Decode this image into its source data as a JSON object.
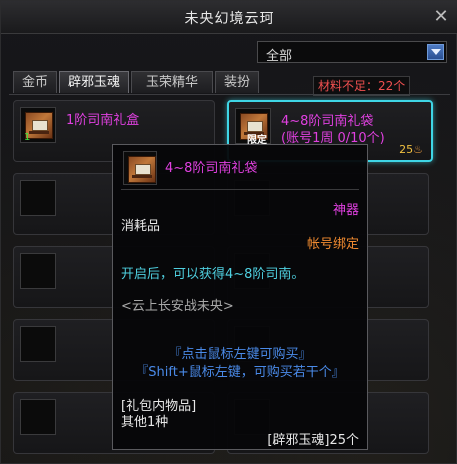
{
  "window": {
    "title": "未央幻境云珂",
    "close_glyph": "✕"
  },
  "filter": {
    "selected": "全部"
  },
  "tabs": [
    {
      "label": "金币",
      "active": false
    },
    {
      "label": "辟邪玉魂",
      "active": true
    },
    {
      "label": "玉荣精华",
      "active": false
    },
    {
      "label": "装扮",
      "active": false
    }
  ],
  "materials": {
    "shortage_text": "材料不足：22个"
  },
  "items": {
    "item1": {
      "name": "1阶司南礼盒",
      "count": "1"
    },
    "item2": {
      "name_line1": "4~8阶司南礼袋",
      "name_line2": "(账号1周 0/10个)",
      "tag": "限定",
      "price": "25"
    }
  },
  "tooltip": {
    "title": "4~8阶司南礼袋",
    "rarity": "神器",
    "type": "消耗品",
    "binding": "帐号绑定",
    "effect": "开启后，可以获得4~8阶司南。",
    "set": "<云上长安战未央>",
    "hint_click": "『点击鼠标左键可购买』",
    "hint_shift": "『Shift+鼠标左键，可购买若干个』",
    "contents_header": "[礼包内物品]",
    "contents_value": "其他1种",
    "cost": "[辟邪玉魂]25个"
  },
  "colors": {
    "rarity": "#e040e0",
    "selected_border": "#3fd6e6",
    "binding": "#f08a30",
    "effect": "#4fd0e0",
    "hint": "#4a8ae8",
    "shortage": "#f05050"
  }
}
